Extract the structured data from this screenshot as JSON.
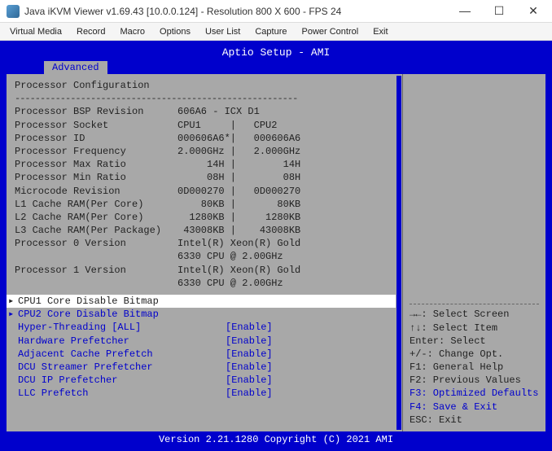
{
  "window": {
    "title": "Java iKVM Viewer v1.69.43 [10.0.0.124]  - Resolution 800 X 600 - FPS 24"
  },
  "menu": {
    "items": [
      "Virtual Media",
      "Record",
      "Macro",
      "Options",
      "User List",
      "Capture",
      "Power Control",
      "Exit"
    ]
  },
  "bios": {
    "title": "Aptio Setup - AMI",
    "tab": "Advanced",
    "section": "Processor Configuration",
    "info": [
      {
        "label": "Processor BSP Revision",
        "val": "606A6 - ICX D1"
      },
      {
        "label": "Processor Socket",
        "val": "CPU1     |   CPU2"
      },
      {
        "label": "Processor ID",
        "val": "000606A6*|   000606A6"
      },
      {
        "label": "Processor Frequency",
        "val": "2.000GHz |   2.000GHz"
      },
      {
        "label": "Processor Max Ratio",
        "val": "     14H |        14H"
      },
      {
        "label": "Processor Min Ratio",
        "val": "     08H |        08H"
      },
      {
        "label": "Microcode Revision",
        "val": "0D000270 |   0D000270"
      },
      {
        "label": "L1 Cache RAM(Per Core)",
        "val": "    80KB |       80KB"
      },
      {
        "label": "L2 Cache RAM(Per Core)",
        "val": "  1280KB |     1280KB"
      },
      {
        "label": "L3 Cache RAM(Per Package)",
        "val": " 43008KB |    43008KB"
      },
      {
        "label": "Processor 0 Version",
        "val": "Intel(R) Xeon(R) Gold"
      },
      {
        "label": "",
        "val": "6330 CPU @ 2.00GHz"
      },
      {
        "label": "Processor 1 Version",
        "val": "Intel(R) Xeon(R) Gold"
      },
      {
        "label": "",
        "val": "6330 CPU @ 2.00GHz"
      }
    ],
    "settings": [
      {
        "label": "CPU1 Core Disable Bitmap",
        "val": "",
        "active": true,
        "sub": true
      },
      {
        "label": "CPU2 Core Disable Bitmap",
        "val": "",
        "sub": true
      },
      {
        "label": "Hyper-Threading [ALL]",
        "val": "[Enable]"
      },
      {
        "label": "Hardware Prefetcher",
        "val": "[Enable]"
      },
      {
        "label": "Adjacent Cache Prefetch",
        "val": "[Enable]"
      },
      {
        "label": "DCU Streamer Prefetcher",
        "val": "[Enable]"
      },
      {
        "label": "DCU IP Prefetcher",
        "val": "[Enable]"
      },
      {
        "label": "LLC Prefetch",
        "val": "[Enable]"
      }
    ],
    "help": [
      {
        "text": "→←: Select Screen"
      },
      {
        "text": "↑↓: Select Item"
      },
      {
        "text": "Enter: Select"
      },
      {
        "text": "+/-: Change Opt."
      },
      {
        "text": "F1: General Help"
      },
      {
        "text": "F2: Previous Values"
      },
      {
        "text": "F3: Optimized Defaults",
        "blue": true
      },
      {
        "text": "F4: Save & Exit",
        "blue": true
      },
      {
        "text": "ESC: Exit"
      }
    ],
    "footer": "Version 2.21.1280 Copyright (C) 2021 AMI"
  }
}
